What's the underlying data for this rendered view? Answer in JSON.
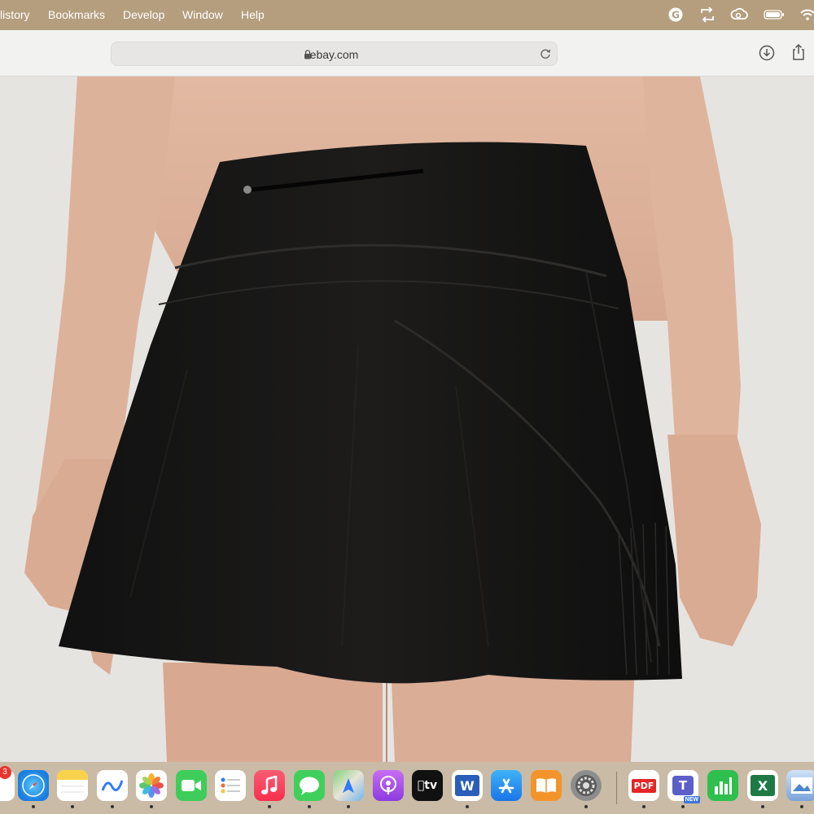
{
  "menubar": {
    "items": [
      "listory",
      "Bookmarks",
      "Develop",
      "Window",
      "Help"
    ],
    "status_icons": [
      "grammarly-icon",
      "sync-icon",
      "creative-cloud-icon",
      "battery-icon",
      "wifi-icon"
    ]
  },
  "browser": {
    "url": "ebay.com",
    "toolbar_icons": [
      "download-icon",
      "share-icon"
    ]
  },
  "content": {
    "image": "product-photo-black-skirt"
  },
  "dock": {
    "calendar_badge": "3",
    "apps": [
      "calendar",
      "safari",
      "notes",
      "freeform",
      "photos",
      "facetime",
      "reminders",
      "music",
      "messages",
      "maps",
      "podcasts",
      "apple-tv",
      "word",
      "app-store",
      "books",
      "system-preferences",
      "pdf-editor",
      "teams",
      "numbers",
      "excel",
      "preview"
    ],
    "labels": {
      "tv": "tv",
      "word": "W",
      "excel": "X",
      "pdf": "PDF",
      "teams_new": "NEW"
    }
  },
  "colors": {
    "menubar": "#b49e7e",
    "toolbar": "#f2f2f1",
    "dock": "#c9bba6",
    "skirt": "#141312"
  }
}
